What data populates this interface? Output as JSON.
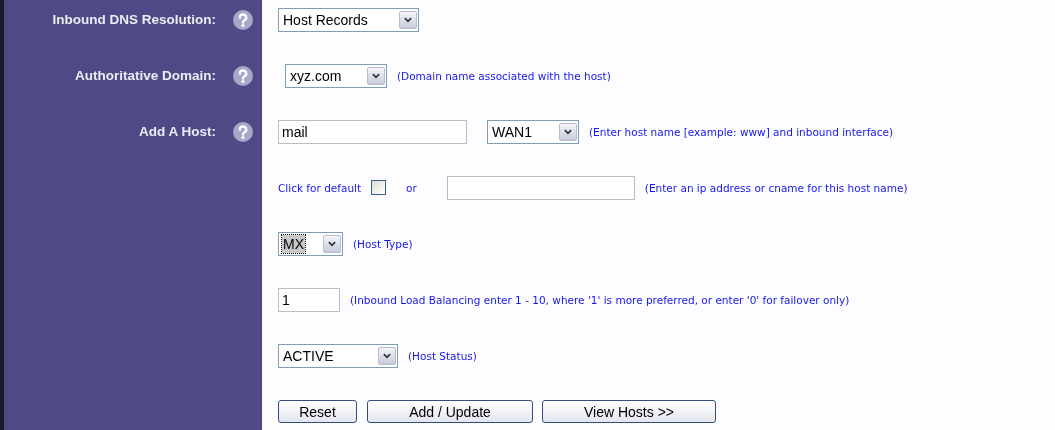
{
  "rows": [
    {
      "label": "Inbound DNS Resolution:",
      "items": [
        {
          "kind": "select",
          "value": "Host Records",
          "focused": false
        }
      ]
    },
    {
      "label": "Authoritative Domain:",
      "items": [
        {
          "kind": "select",
          "value": "xyz.com",
          "focused": false
        },
        {
          "kind": "hint",
          "text": "(Domain name associated with the host)"
        }
      ]
    },
    {
      "label": "Add A Host:",
      "items": [
        {
          "kind": "input",
          "value": "mail"
        },
        {
          "kind": "select",
          "value": "WAN1",
          "focused": false
        },
        {
          "kind": "hint",
          "text": "(Enter host name [example: www] and inbound interface)"
        }
      ]
    },
    {
      "items": [
        {
          "kind": "text",
          "text": "Click for default"
        },
        {
          "kind": "checkbox",
          "checked": false
        },
        {
          "kind": "text",
          "text": "or"
        },
        {
          "kind": "input"
        },
        {
          "kind": "hint",
          "text": "(Enter an ip address or cname for this host name)"
        }
      ]
    },
    {
      "items": [
        {
          "kind": "select",
          "value": "MX",
          "focused": true
        },
        {
          "kind": "hint",
          "text": "(Host Type)"
        }
      ]
    },
    {
      "items": [
        {
          "kind": "input",
          "value": "1"
        },
        {
          "kind": "hint",
          "text": "(Inbound Load Balancing enter 1 - 10, where '1' is more preferred, or enter '0' for failover only)"
        }
      ]
    },
    {
      "items": [
        {
          "kind": "select",
          "value": "ACTIVE",
          "focused": false
        },
        {
          "kind": "hint",
          "text": "(Host Status)"
        }
      ]
    },
    {
      "items": [
        {
          "kind": "button",
          "label": "Reset"
        },
        {
          "kind": "button",
          "label": "Add / Update"
        },
        {
          "kind": "button",
          "label": "View Hosts >>"
        }
      ]
    }
  ]
}
